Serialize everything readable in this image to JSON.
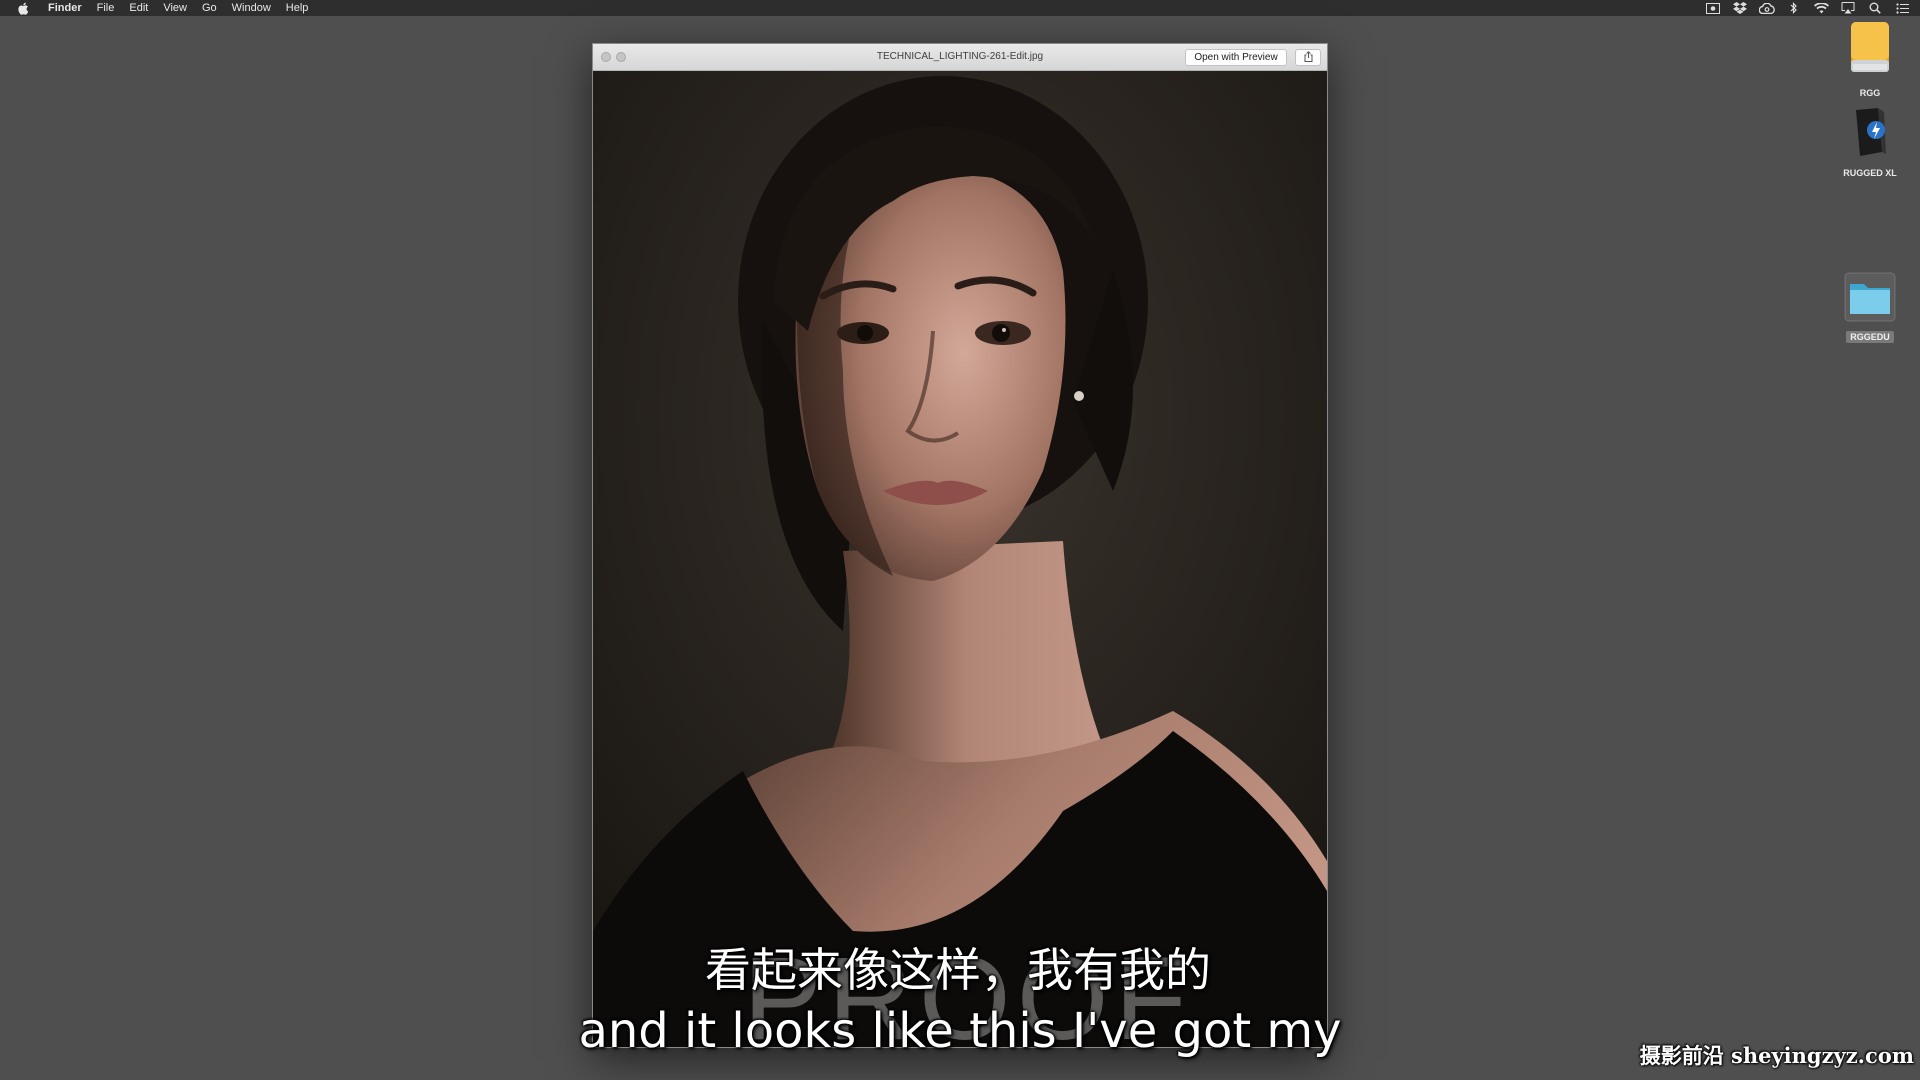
{
  "menubar": {
    "apple_icon": "apple-icon",
    "app_name": "Finder",
    "items": [
      "File",
      "Edit",
      "View",
      "Go",
      "Window",
      "Help"
    ],
    "status_icons": [
      "screen-record-icon",
      "dropbox-icon",
      "creative-cloud-icon",
      "bluetooth-icon",
      "wifi-icon",
      "airplay-icon",
      "spotlight-search-icon",
      "notification-center-icon"
    ]
  },
  "quicklook": {
    "title": "TECHNICAL_LIGHTING-261-Edit.jpg",
    "open_button": "Open with Preview",
    "share_icon": "share-icon",
    "watermark_text": "PROOF"
  },
  "subtitles": {
    "chinese": "看起来像这样，我有我的",
    "english": "and it looks like this I've got my"
  },
  "desktop": {
    "icons": [
      {
        "label": "RGG",
        "icon": "external-drive-icon"
      },
      {
        "label": "RUGGED XL",
        "icon": "thunderbolt-drive-icon"
      },
      {
        "label": "RGGEDU",
        "icon": "folder-icon"
      }
    ]
  },
  "site_watermark": "摄影前沿 sheyingzyz.com"
}
